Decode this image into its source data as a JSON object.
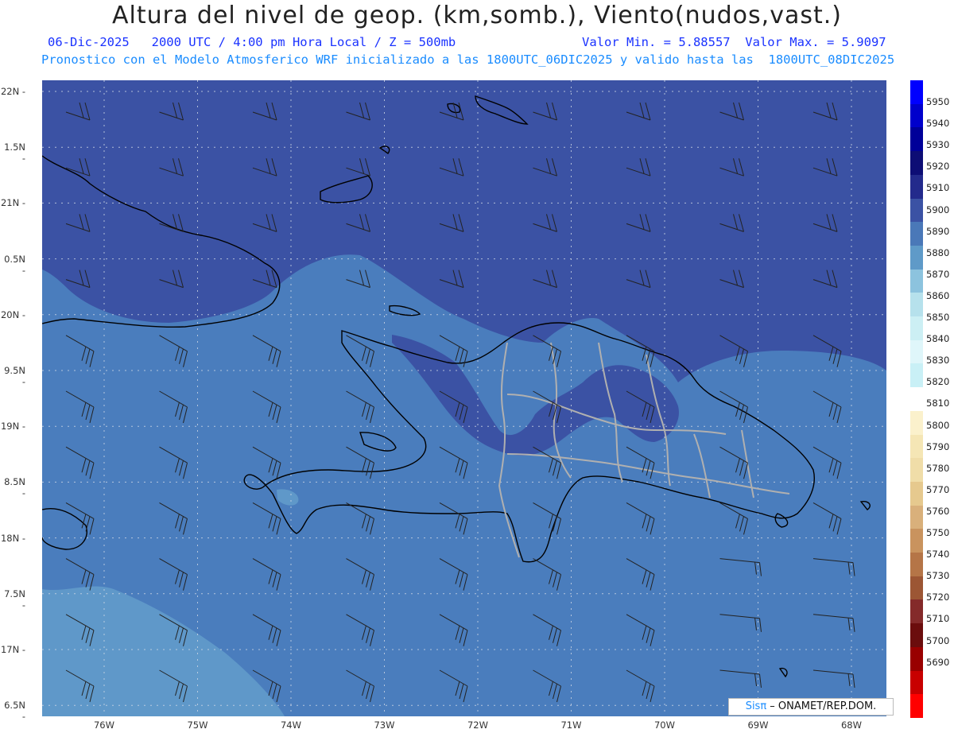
{
  "header": {
    "title": "Altura del nivel de geop. (km,somb.), Viento(nudos,vast.)",
    "line2_left": "06-Dic-2025   2000 UTC / 4:00 pm Hora Local / Z = 500mb",
    "line2_right": "Valor Min. = 5.88557  Valor Max. = 5.9097",
    "line3": "Pronostico con el Modelo Atmosferico WRF inicializado a las 1800UTC_06DIC2025 y valido hasta las  1800UTC_08DIC2025"
  },
  "axes": {
    "lat_labels": [
      "22N",
      "1.5N",
      "21N",
      "0.5N",
      "20N",
      "9.5N",
      "19N",
      "8.5N",
      "18N",
      "7.5N",
      "17N",
      "6.5N"
    ],
    "lon_labels": [
      "76W",
      "75W",
      "74W",
      "73W",
      "72W",
      "71W",
      "70W",
      "69W",
      "68W"
    ]
  },
  "legend": {
    "values": [
      "5950",
      "5940",
      "5930",
      "5920",
      "5910",
      "5900",
      "5890",
      "5880",
      "5870",
      "5860",
      "5850",
      "5840",
      "5830",
      "5820",
      "5810",
      "5800",
      "5790",
      "5780",
      "5770",
      "5760",
      "5750",
      "5740",
      "5730",
      "5720",
      "5710",
      "5700",
      "5690"
    ],
    "colors": [
      "#0000ff",
      "#0000cc",
      "#000099",
      "#0d0d75",
      "#232a8c",
      "#3b52a4",
      "#4a78b8",
      "#5f9ac8",
      "#8cc3de",
      "#b6e1ec",
      "#cceff4",
      "#dff6fa",
      "#c9f0f6",
      "#ffffff",
      "#fbf1cc",
      "#f5e6b5",
      "#f0dda8",
      "#e6c98e",
      "#d9b07b",
      "#c9935e",
      "#b57547",
      "#9c5634",
      "#842a2a",
      "#6b0d0d",
      "#990000",
      "#c80000",
      "#ff0000"
    ]
  },
  "fields": {
    "colors": {
      "high": "#3b52a4",
      "mid": "#4a7dbd",
      "low": "#5f98c9",
      "land_line": "#000000",
      "border_line": "#b0b0b0"
    }
  },
  "credit": {
    "sis": "Sis",
    "pi": "π",
    "rest": " – ONAMET/REP.DOM."
  }
}
